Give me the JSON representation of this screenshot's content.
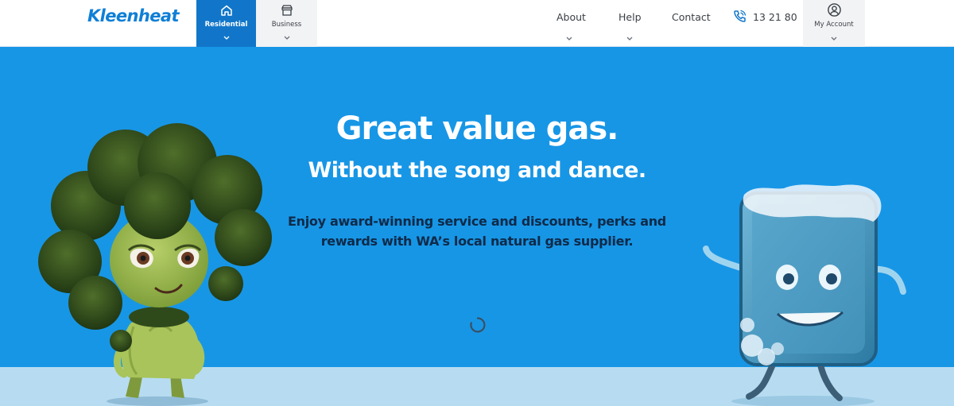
{
  "header": {
    "logo": "Kleenheat",
    "tabs": [
      {
        "label": "Residential",
        "icon": "home-icon",
        "active": true
      },
      {
        "label": "Business",
        "icon": "store-icon",
        "active": false
      }
    ],
    "links": [
      {
        "label": "About"
      },
      {
        "label": "Help"
      },
      {
        "label": "Contact"
      }
    ],
    "phone": "13 21 80",
    "account_label": "My Account"
  },
  "hero": {
    "title": "Great value gas.",
    "subtitle": "Without the song and dance.",
    "description_line1": "Enjoy award-winning service and discounts, perks and",
    "description_line2": "rewards with WA’s local natural gas supplier."
  },
  "colors": {
    "brand_blue": "#0f7fd6",
    "active_tab": "#1176c9",
    "hero_background": "#1796e6",
    "floor": "#b7dcf1",
    "description_text": "#0f2a48"
  }
}
